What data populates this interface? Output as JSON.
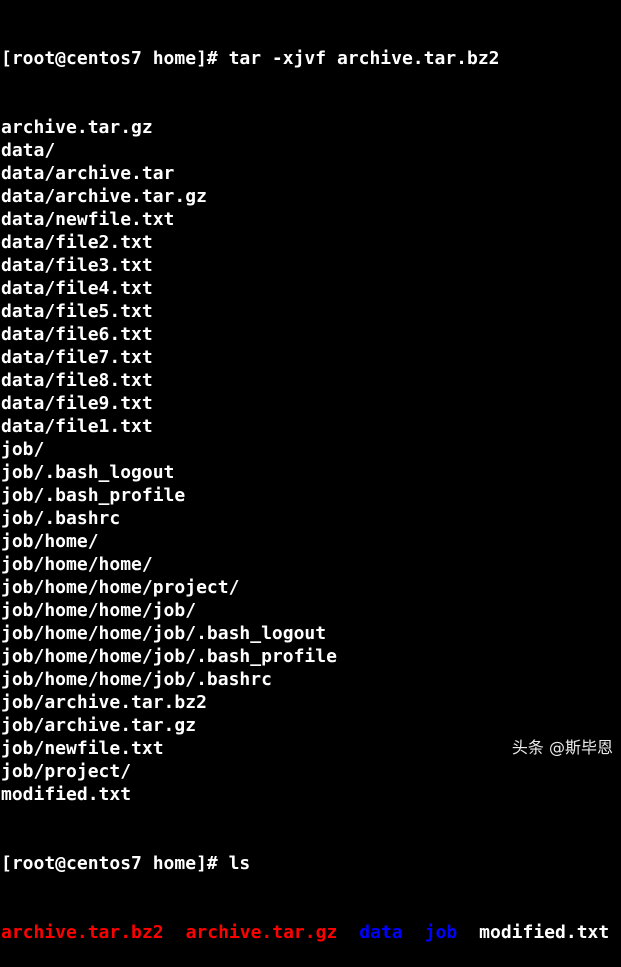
{
  "terminal": {
    "prompt_command": "[root@centos7 home]# tar -xjvf archive.tar.bz2",
    "output_lines": [
      "archive.tar.gz",
      "data/",
      "data/archive.tar",
      "data/archive.tar.gz",
      "data/newfile.txt",
      "data/file2.txt",
      "data/file3.txt",
      "data/file4.txt",
      "data/file5.txt",
      "data/file6.txt",
      "data/file7.txt",
      "data/file8.txt",
      "data/file9.txt",
      "data/file1.txt",
      "job/",
      "job/.bash_logout",
      "job/.bash_profile",
      "job/.bashrc",
      "job/home/",
      "job/home/home/",
      "job/home/home/project/",
      "job/home/home/job/",
      "job/home/home/job/.bash_logout",
      "job/home/home/job/.bash_profile",
      "job/home/home/job/.bashrc",
      "job/archive.tar.bz2",
      "job/archive.tar.gz",
      "job/newfile.txt",
      "job/project/",
      "modified.txt"
    ],
    "ls_command": "[root@centos7 home]# ls",
    "ls_items": [
      {
        "name": "archive.tar.bz2",
        "color": "#ff0000"
      },
      {
        "name": "archive.tar.gz",
        "color": "#ff0000"
      },
      {
        "name": "data",
        "color": "#0000ff"
      },
      {
        "name": "job",
        "color": "#0000ff"
      },
      {
        "name": "modified.txt",
        "color": "#ffffff"
      }
    ]
  },
  "watermark": "头条 @斯毕恩",
  "colors": {
    "background": "#000000",
    "text": "#ffffff",
    "archive": "#ff0000",
    "directory": "#0000ff"
  }
}
